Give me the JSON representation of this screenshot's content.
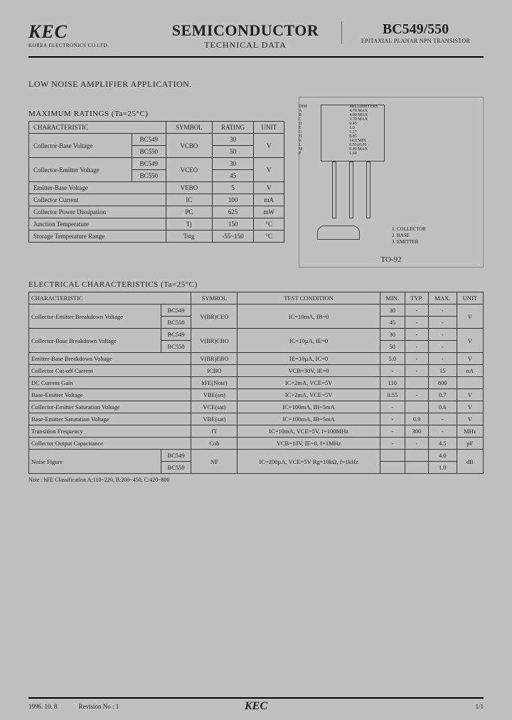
{
  "header": {
    "logo": "KEC",
    "logo_sub": "KOREA ELECTRONICS CO.LTD.",
    "center_main": "SEMICONDUCTOR",
    "center_sub": "TECHNICAL DATA",
    "right_main": "BC549/550",
    "right_sub": "EPITAXIAL PLANAR NPN TRANSISTOR"
  },
  "application": "LOW NOISE AMPLIFIER APPLICATION.",
  "max_ratings": {
    "title": "MAXIMUM RATINGS (Ta=25°C)",
    "head": {
      "char": "CHARACTERISTIC",
      "sym": "SYMBOL",
      "rating": "RATING",
      "unit": "UNIT"
    },
    "rows": [
      {
        "char": "Collector-Base Voltage",
        "sub": "BC549",
        "sym": "VCBO",
        "rating": "30",
        "unit": "V"
      },
      {
        "char": "",
        "sub": "BC550",
        "sym": "",
        "rating": "50",
        "unit": ""
      },
      {
        "char": "Collector-Emitter Voltage",
        "sub": "BC549",
        "sym": "VCEO",
        "rating": "30",
        "unit": "V"
      },
      {
        "char": "",
        "sub": "BC550",
        "sym": "",
        "rating": "45",
        "unit": ""
      },
      {
        "char": "Emitter-Base Voltage",
        "sub": "",
        "sym": "VEBO",
        "rating": "5",
        "unit": "V"
      },
      {
        "char": "Collector Current",
        "sub": "",
        "sym": "IC",
        "rating": "100",
        "unit": "mA"
      },
      {
        "char": "Collector Power Dissipation",
        "sub": "",
        "sym": "PC",
        "rating": "625",
        "unit": "mW"
      },
      {
        "char": "Junction Temperature",
        "sub": "",
        "sym": "Tj",
        "rating": "150",
        "unit": "°C"
      },
      {
        "char": "Storage Temperature Range",
        "sub": "",
        "sym": "Tstg",
        "rating": "-55~150",
        "unit": "°C"
      }
    ]
  },
  "package": {
    "label": "TO-92",
    "dims_head": {
      "sym": "DIM",
      "mm": "MILLIMETERS"
    },
    "dims": [
      {
        "s": "A",
        "v": "4.70 MAX"
      },
      {
        "s": "B",
        "v": "4.80 MAX"
      },
      {
        "s": "C",
        "v": "3.70 MAX"
      },
      {
        "s": "D",
        "v": "0.45"
      },
      {
        "s": "E",
        "v": "1.0"
      },
      {
        "s": "G",
        "v": "1.27"
      },
      {
        "s": "H",
        "v": "0.85"
      },
      {
        "s": "K",
        "v": "14.0 MIN"
      },
      {
        "s": "L",
        "v": "0.55±0.05"
      },
      {
        "s": "M",
        "v": "0.40 MAX"
      },
      {
        "s": "P",
        "v": "1.60"
      }
    ],
    "pins": {
      "p1": "1. COLLECTOR",
      "p2": "2. BASE",
      "p3": "3. EMITTER"
    }
  },
  "elec": {
    "title": "ELECTRICAL CHARACTERISTICS (Ta=25°C)",
    "head": {
      "char": "CHARACTERISTIC",
      "sym": "SYMBOL",
      "cond": "TEST CONDITION",
      "min": "MIN.",
      "typ": "TYP.",
      "max": "MAX.",
      "unit": "UNIT"
    },
    "rows": [
      {
        "char": "Collector-Emitter Breakdown Voltage",
        "sub": "BC549",
        "sym": "V(BR)CEO",
        "cond": "IC=10mA, IB=0",
        "min": "30",
        "typ": "-",
        "max": "-",
        "unit": "V"
      },
      {
        "char": "",
        "sub": "BC550",
        "sym": "",
        "cond": "",
        "min": "45",
        "typ": "-",
        "max": "-",
        "unit": ""
      },
      {
        "char": "Collector-Base Breakdown Voltage",
        "sub": "BC549",
        "sym": "V(BR)CBO",
        "cond": "IC=10µA, IE=0",
        "min": "30",
        "typ": "-",
        "max": "-",
        "unit": "V"
      },
      {
        "char": "",
        "sub": "BC550",
        "sym": "",
        "cond": "",
        "min": "50",
        "typ": "-",
        "max": "-",
        "unit": ""
      },
      {
        "char": "Emitter-Base Breakdown Voltage",
        "sub": "",
        "sym": "V(BR)EBO",
        "cond": "IE=10µA, IC=0",
        "min": "5.0",
        "typ": "-",
        "max": "-",
        "unit": "V"
      },
      {
        "char": "Collector Cut-off Current",
        "sub": "",
        "sym": "ICBO",
        "cond": "VCB=30V, IE=0",
        "min": "-",
        "typ": "-",
        "max": "15",
        "unit": "nA"
      },
      {
        "char": "DC Current Gain",
        "sub": "",
        "sym": "hFE(Note)",
        "cond": "IC=2mA, VCE=5V",
        "min": "110",
        "typ": "",
        "max": "800",
        "unit": ""
      },
      {
        "char": "Base-Emitter Voltage",
        "sub": "",
        "sym": "VBE(on)",
        "cond": "IC=2mA, VCE=5V",
        "min": "0.55",
        "typ": "-",
        "max": "0.7",
        "unit": "V"
      },
      {
        "char": "Collector-Emitter Saturation Voltage",
        "sub": "",
        "sym": "VCE(sat)",
        "cond": "IC=100mA, IB=5mA",
        "min": "-",
        "typ": "",
        "max": "0.6",
        "unit": "V"
      },
      {
        "char": "Base-Emitter Saturation Voltage",
        "sub": "",
        "sym": "VBE(sat)",
        "cond": "IC=100mA, IB=5mA",
        "min": "-",
        "typ": "0.9",
        "max": "-",
        "unit": "V"
      },
      {
        "char": "Transition Frequency",
        "sub": "",
        "sym": "fT",
        "cond": "IC=10mA, VCE=5V, f=100MHz",
        "min": "-",
        "typ": "300",
        "max": "-",
        "unit": "MHz"
      },
      {
        "char": "Collector Output Capacitance",
        "sub": "",
        "sym": "Cob",
        "cond": "VCB=10V, IE=0, f=1MHz",
        "min": "-",
        "typ": "-",
        "max": "4.5",
        "unit": "pF"
      },
      {
        "char": "Noise Figure",
        "sub": "BC549",
        "sym": "NF",
        "cond": "IC=200µA, VCE=5V Rg=10kΩ, f=1kHz",
        "min": "",
        "typ": "",
        "max": "4.0",
        "unit": "dB"
      },
      {
        "char": "",
        "sub": "BC550",
        "sym": "",
        "cond": "",
        "min": "",
        "typ": "",
        "max": "1.0",
        "unit": ""
      }
    ],
    "note": "Note : hFE Classification   A:110~220,   B:200~450,   C:420~800"
  },
  "footer": {
    "date": "1996. 10. 8",
    "rev": "Revision No : 1",
    "logo": "KEC",
    "page": "1/1"
  }
}
